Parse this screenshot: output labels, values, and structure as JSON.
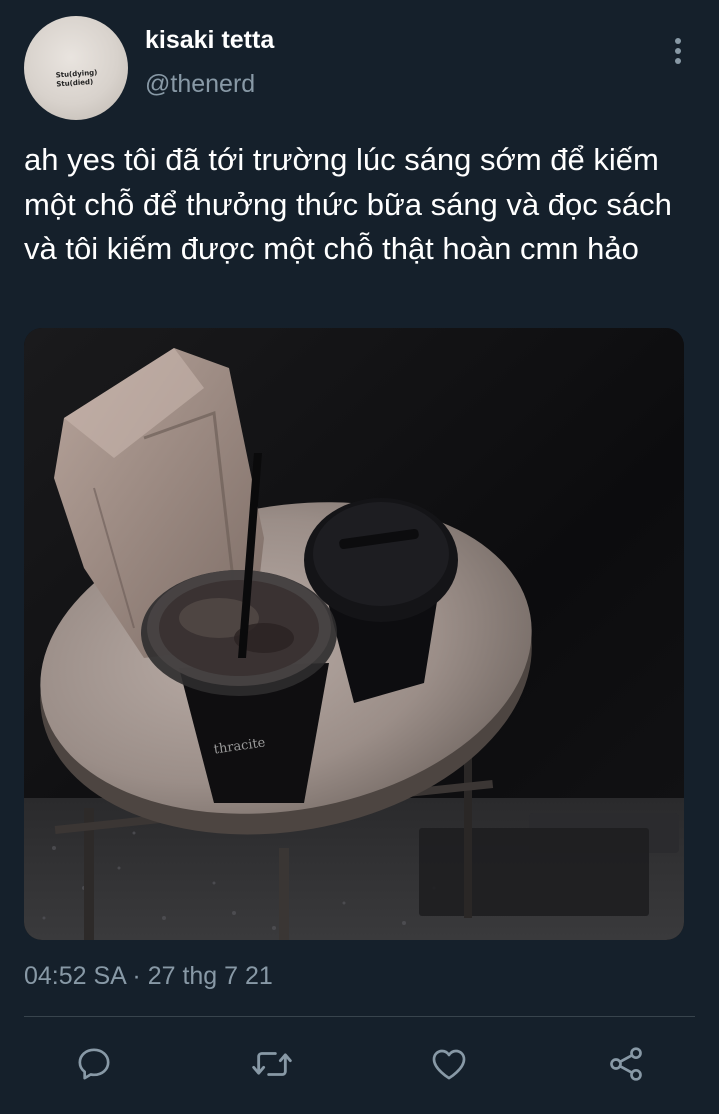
{
  "user": {
    "display_name": "kisaki tetta",
    "handle": "@thenerd",
    "avatar_shirt_text": [
      "Stu(dying)",
      "Stu(died)"
    ]
  },
  "tweet": {
    "text": "ah yes tôi đã tới trường lúc sáng sớm để kiếm một chỗ để thưởng thức bữa sáng và đọc sách và tôi kiếm được một chỗ thật hoàn cmn hảo",
    "cup_print": "thracite",
    "timestamp": "04:52 SA · 27 thg 7 21"
  },
  "actions": {
    "reply": "reply-icon",
    "retweet": "retweet-icon",
    "like": "heart-icon",
    "share": "share-icon"
  },
  "colors": {
    "background": "#15202b",
    "primary_text": "#ffffff",
    "secondary_text": "#8899a6",
    "divider": "#38444d"
  }
}
